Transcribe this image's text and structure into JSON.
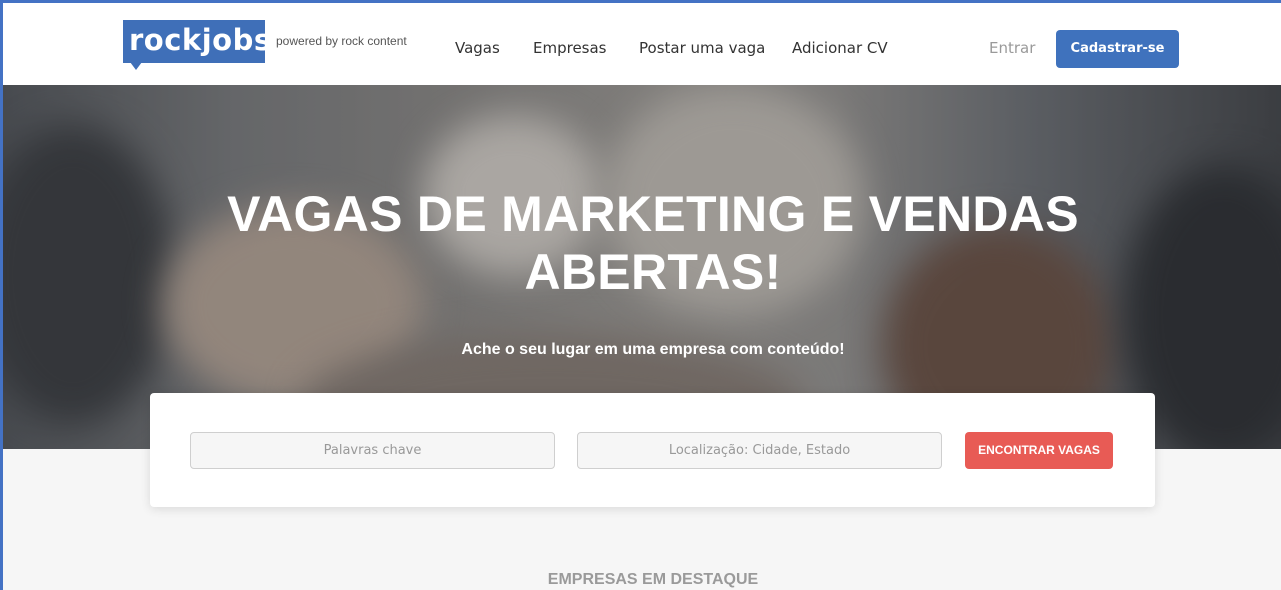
{
  "brand": {
    "logo_text": "rockjobs",
    "powered_by": "powered by rock content",
    "logo_color": "#3f6fb8"
  },
  "nav": {
    "items": [
      {
        "label": "Vagas"
      },
      {
        "label": "Empresas"
      },
      {
        "label": "Postar uma vaga"
      },
      {
        "label": "Adicionar CV"
      }
    ],
    "login_label": "Entrar",
    "signup_label": "Cadastrar-se",
    "signup_color": "#3f72bd"
  },
  "hero": {
    "title_line1": "VAGAS DE MARKETING E VENDAS",
    "title_line2": "ABERTAS!",
    "subtitle": "Ache o seu lugar em uma empresa com conteúdo!"
  },
  "search": {
    "keywords_placeholder": "Palavras chave",
    "location_placeholder": "Localização: Cidade, Estado",
    "button_label": "ENCONTRAR VAGAS",
    "button_color": "#e85b55"
  },
  "featured": {
    "title": "EMPRESAS EM DESTAQUE"
  }
}
